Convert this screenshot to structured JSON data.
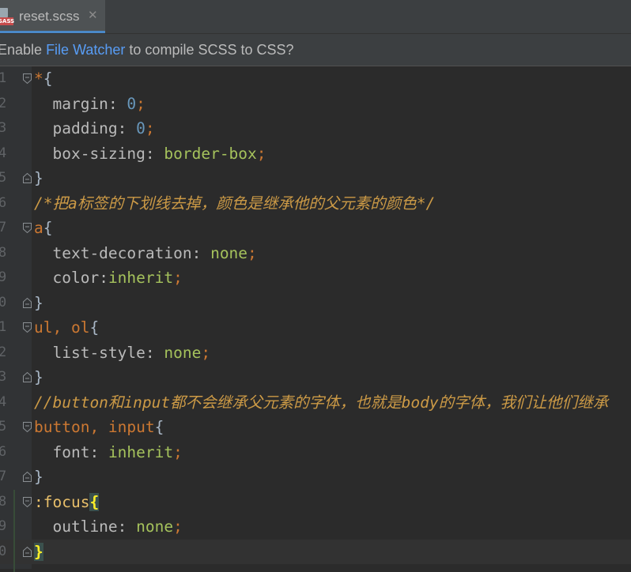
{
  "tab": {
    "icon_badge": "SASS",
    "filename": "reset.scss",
    "close": "✕"
  },
  "banner": {
    "prefix": "Enable ",
    "link": "File Watcher",
    "suffix": " to compile SCSS to CSS?"
  },
  "editor": {
    "line_numbers": [
      "1",
      "2",
      "3",
      "4",
      "5",
      "6",
      "7",
      "8",
      "9",
      "0",
      "1",
      "2",
      "3",
      "4",
      "5",
      "6",
      "7",
      "8",
      "9",
      "0"
    ],
    "lines": [
      {
        "kind": "sel_open",
        "selector": "*",
        "brace": "{"
      },
      {
        "kind": "decl",
        "prop": "margin",
        "sep": ": ",
        "value": "0",
        "vtype": "num"
      },
      {
        "kind": "decl",
        "prop": "padding",
        "sep": ": ",
        "value": "0",
        "vtype": "num"
      },
      {
        "kind": "decl",
        "prop": "box-sizing",
        "sep": ": ",
        "value": "border-box",
        "vtype": "val"
      },
      {
        "kind": "close",
        "brace": "}"
      },
      {
        "kind": "comment",
        "text": "/*把a标签的下划线去掉，颜色是继承他的父元素的颜色*/"
      },
      {
        "kind": "sel_open",
        "selector": "a",
        "brace": "{"
      },
      {
        "kind": "decl",
        "prop": "text-decoration",
        "sep": ": ",
        "value": "none",
        "vtype": "val"
      },
      {
        "kind": "decl",
        "prop": "color",
        "sep": ":",
        "value": "inherit",
        "vtype": "val"
      },
      {
        "kind": "close",
        "brace": "}"
      },
      {
        "kind": "sel_open",
        "selector": "ul, ol",
        "brace": "{"
      },
      {
        "kind": "decl",
        "prop": "list-style",
        "sep": ": ",
        "value": "none",
        "vtype": "val"
      },
      {
        "kind": "close",
        "brace": "}"
      },
      {
        "kind": "comment",
        "text": "//button和input都不会继承父元素的字体，也就是body的字体，我们让他们继承"
      },
      {
        "kind": "sel_open",
        "selector": "button, input",
        "brace": "{"
      },
      {
        "kind": "decl",
        "prop": "font",
        "sep": ": ",
        "value": "inherit",
        "vtype": "val"
      },
      {
        "kind": "close",
        "brace": "}"
      },
      {
        "kind": "pseudo_open",
        "selector": ":focus",
        "brace": "{"
      },
      {
        "kind": "decl",
        "prop": "outline",
        "sep": ": ",
        "value": "none",
        "vtype": "val"
      },
      {
        "kind": "close_hl",
        "brace": "}"
      }
    ],
    "current_line": 20
  },
  "colors": {
    "background": "#2b2b2b",
    "selector": "#cc7832",
    "number": "#6897bb",
    "value": "#a5c25c",
    "comment": "#cc9a46",
    "link": "#589df6",
    "matched_brace": "#ffef28"
  }
}
